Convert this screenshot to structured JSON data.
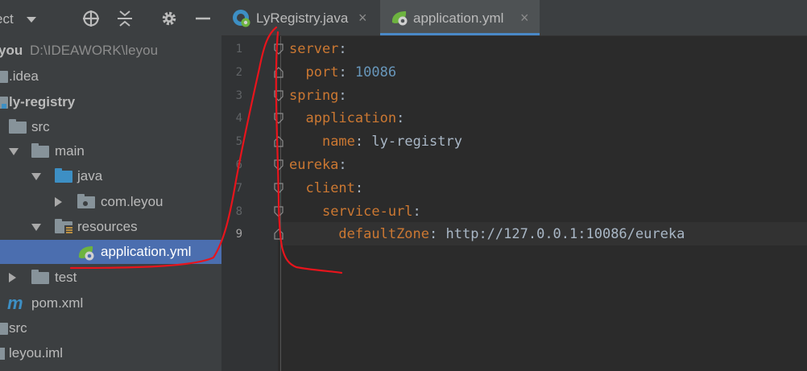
{
  "project_panel": {
    "title": "ect",
    "toolbar_icons": [
      "locate-icon",
      "collapse-all-icon",
      "gear-icon",
      "hide-icon"
    ],
    "tree": {
      "root": {
        "name": "you",
        "path": "D:\\IDEAWORK\\leyou"
      },
      "idea": ".idea",
      "module": "ly-registry",
      "src": "src",
      "main": "main",
      "java": "java",
      "package": "com.leyou",
      "resources": "resources",
      "config_file": "application.yml",
      "test": "test",
      "pom": "pom.xml",
      "root_src": "src",
      "iml": "leyou.iml"
    }
  },
  "editor": {
    "tabs": [
      {
        "label": "LyRegistry.java",
        "close": "×",
        "icon": "spring-boot-class-icon",
        "active": false
      },
      {
        "label": "application.yml",
        "close": "×",
        "icon": "spring-config-icon",
        "active": true
      }
    ],
    "line_numbers": [
      "1",
      "2",
      "3",
      "4",
      "5",
      "6",
      "7",
      "8",
      "9"
    ],
    "current_line": 9,
    "lines": [
      {
        "indent": "",
        "key": "server",
        "sep": ":",
        "value": "",
        "value_type": ""
      },
      {
        "indent": "  ",
        "key": "port",
        "sep": ": ",
        "value": "10086",
        "value_type": "number"
      },
      {
        "indent": "",
        "key": "spring",
        "sep": ":",
        "value": "",
        "value_type": ""
      },
      {
        "indent": "  ",
        "key": "application",
        "sep": ":",
        "value": "",
        "value_type": ""
      },
      {
        "indent": "    ",
        "key": "name",
        "sep": ": ",
        "value": "ly-registry",
        "value_type": "string"
      },
      {
        "indent": "",
        "key": "eureka",
        "sep": ":",
        "value": "",
        "value_type": ""
      },
      {
        "indent": "  ",
        "key": "client",
        "sep": ":",
        "value": "",
        "value_type": ""
      },
      {
        "indent": "    ",
        "key": "service-url",
        "sep": ":",
        "value": "",
        "value_type": ""
      },
      {
        "indent": "      ",
        "key": "defaultZone",
        "sep": ": ",
        "value": "http://127.0.0.1:10086/eureka",
        "value_type": "string"
      }
    ]
  },
  "colors": {
    "yaml_key": "#cc7832",
    "yaml_number": "#6897bb",
    "yaml_text": "#a9b7c6",
    "selection": "#4b6eaf",
    "annotation": "#e8141c"
  }
}
